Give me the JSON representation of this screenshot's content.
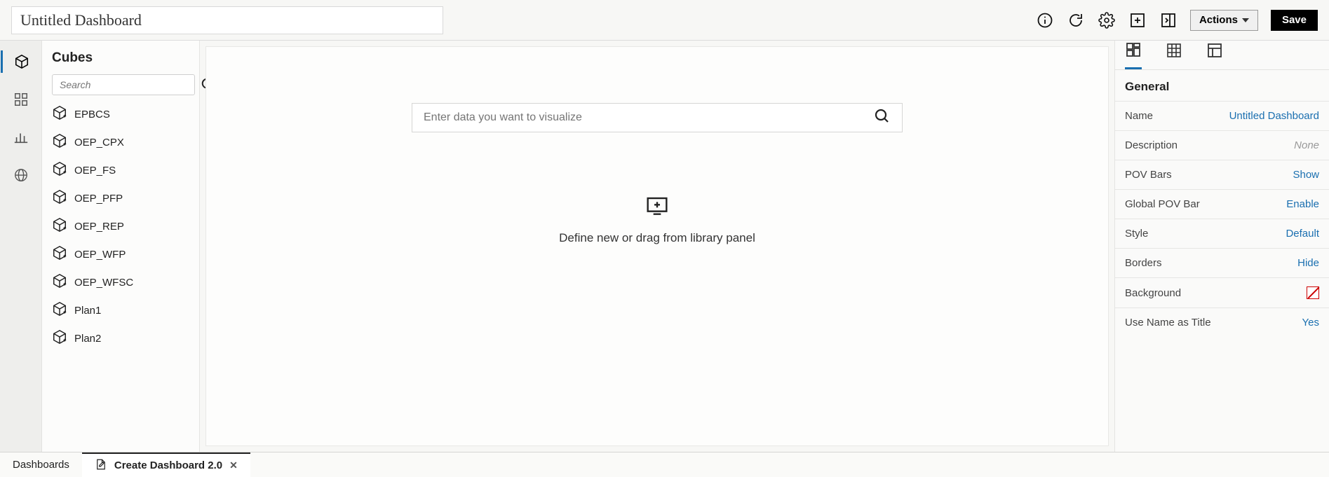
{
  "header": {
    "title_value": "Untitled Dashboard",
    "actions_label": "Actions",
    "save_label": "Save"
  },
  "left_rail": {
    "items": [
      {
        "name": "cubes",
        "icon": "cube-icon",
        "active": true
      },
      {
        "name": "library",
        "icon": "grid-icon",
        "active": false
      },
      {
        "name": "visualizations",
        "icon": "bar-chart-icon",
        "active": false
      },
      {
        "name": "global",
        "icon": "globe-icon",
        "active": false
      }
    ]
  },
  "cubes_panel": {
    "title": "Cubes",
    "search_placeholder": "Search",
    "items": [
      {
        "label": "EPBCS"
      },
      {
        "label": "OEP_CPX"
      },
      {
        "label": "OEP_FS"
      },
      {
        "label": "OEP_PFP"
      },
      {
        "label": "OEP_REP"
      },
      {
        "label": "OEP_WFP"
      },
      {
        "label": "OEP_WFSC"
      },
      {
        "label": "Plan1"
      },
      {
        "label": "Plan2"
      }
    ]
  },
  "canvas": {
    "search_placeholder": "Enter data you want to visualize",
    "drop_hint": "Define new or drag from library panel"
  },
  "properties": {
    "section_title": "General",
    "rows": [
      {
        "key": "Name",
        "value": "Untitled Dashboard",
        "kind": "link"
      },
      {
        "key": "Description",
        "value": "None",
        "kind": "none"
      },
      {
        "key": "POV Bars",
        "value": "Show",
        "kind": "link"
      },
      {
        "key": "Global POV Bar",
        "value": "Enable",
        "kind": "link"
      },
      {
        "key": "Style",
        "value": "Default",
        "kind": "link"
      },
      {
        "key": "Borders",
        "value": "Hide",
        "kind": "link"
      },
      {
        "key": "Background",
        "value": "",
        "kind": "swatch"
      },
      {
        "key": "Use Name as Title",
        "value": "Yes",
        "kind": "link"
      }
    ]
  },
  "bottom_tabs": {
    "items": [
      {
        "label": "Dashboards",
        "active": false,
        "closable": false,
        "icon": null
      },
      {
        "label": "Create Dashboard 2.0",
        "active": true,
        "closable": true,
        "icon": "edit-doc-icon"
      }
    ]
  }
}
